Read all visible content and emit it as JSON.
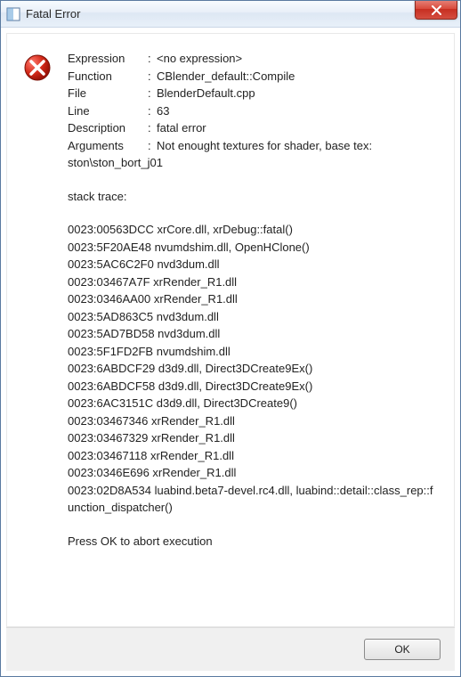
{
  "titlebar": {
    "title": "Fatal Error"
  },
  "error": {
    "fields": [
      {
        "label": "Expression",
        "value": "<no expression>"
      },
      {
        "label": "Function",
        "value": "CBlender_default::Compile"
      },
      {
        "label": "File",
        "value": "BlenderDefault.cpp"
      },
      {
        "label": "Line",
        "value": "63"
      },
      {
        "label": "Description",
        "value": "fatal error"
      },
      {
        "label": "Arguments",
        "value": "Not enought textures for shader, base tex:"
      }
    ],
    "arguments_cont": "ston\\ston_bort_j01",
    "stack_label": "stack trace:",
    "stack": [
      "0023:00563DCC xrCore.dll, xrDebug::fatal()",
      "0023:5F20AE48 nvumdshim.dll, OpenHClone()",
      "0023:5AC6C2F0 nvd3dum.dll",
      "0023:03467A7F xrRender_R1.dll",
      "0023:0346AA00 xrRender_R1.dll",
      "0023:5AD863C5 nvd3dum.dll",
      "0023:5AD7BD58 nvd3dum.dll",
      "0023:5F1FD2FB nvumdshim.dll",
      "0023:6ABDCF29 d3d9.dll, Direct3DCreate9Ex()",
      "0023:6ABDCF58 d3d9.dll, Direct3DCreate9Ex()",
      "0023:6AC3151C d3d9.dll, Direct3DCreate9()",
      "0023:03467346 xrRender_R1.dll",
      "0023:03467329 xrRender_R1.dll",
      "0023:03467118 xrRender_R1.dll",
      "0023:0346E696 xrRender_R1.dll",
      "0023:02D8A534 luabind.beta7-devel.rc4.dll, luabind::detail::class_rep::function_dispatcher()"
    ],
    "press_ok": "Press OK to abort execution"
  },
  "buttons": {
    "ok": "OK"
  }
}
